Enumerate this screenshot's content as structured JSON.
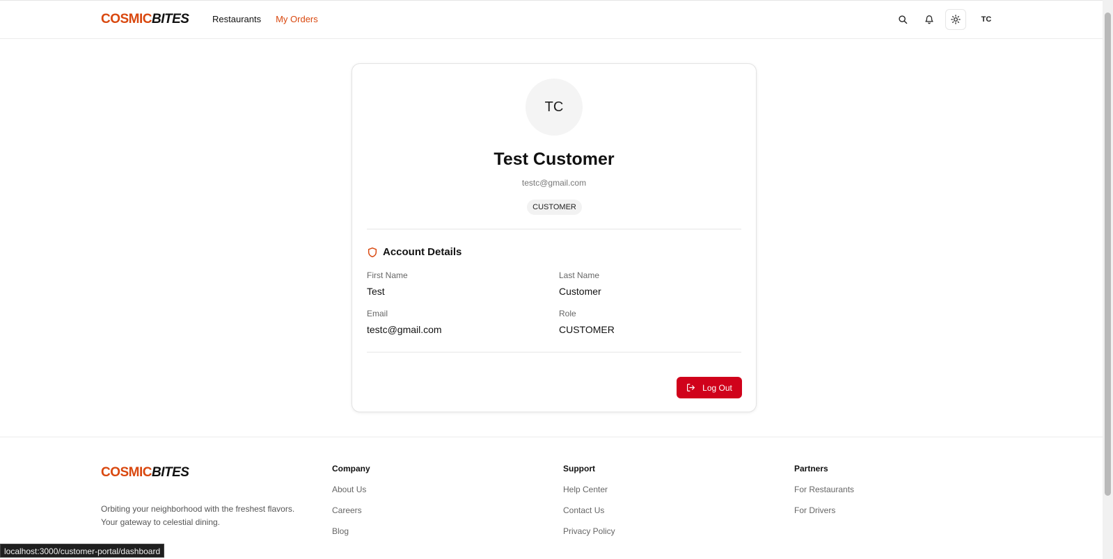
{
  "header": {
    "logo_part1": "COSMIC",
    "logo_part2": "BITES",
    "nav": [
      {
        "label": "Restaurants"
      },
      {
        "label": "My Orders"
      }
    ],
    "icons": [
      "search-icon",
      "bell-icon",
      "sun-icon"
    ],
    "avatar_initials": "TC"
  },
  "profile": {
    "initials": "TC",
    "name": "Test Customer",
    "email": "testc@gmail.com",
    "role_badge": "CUSTOMER",
    "section_title": "Account Details",
    "section_icon": "shield-icon",
    "fields": [
      {
        "label": "First Name",
        "value": "Test"
      },
      {
        "label": "Last Name",
        "value": "Customer"
      },
      {
        "label": "Email",
        "value": "testc@gmail.com"
      },
      {
        "label": "Role",
        "value": "CUSTOMER"
      }
    ],
    "logout_label": "Log Out",
    "logout_icon": "logout-icon"
  },
  "footer": {
    "logo_part1": "COSMIC",
    "logo_part2": "BITES",
    "tagline_line1": "Orbiting your neighborhood with the freshest flavors.",
    "tagline_line2": "Your gateway to celestial dining.",
    "columns": [
      {
        "title": "Company",
        "links": [
          "About Us",
          "Careers",
          "Blog"
        ]
      },
      {
        "title": "Support",
        "links": [
          "Help Center",
          "Contact Us",
          "Privacy Policy"
        ]
      },
      {
        "title": "Partners",
        "links": [
          "For Restaurants",
          "For Drivers"
        ]
      }
    ]
  },
  "status_url": "localhost:3000/customer-portal/dashboard",
  "colors": {
    "brand": "#d9480f",
    "logout": "#d0021b"
  }
}
